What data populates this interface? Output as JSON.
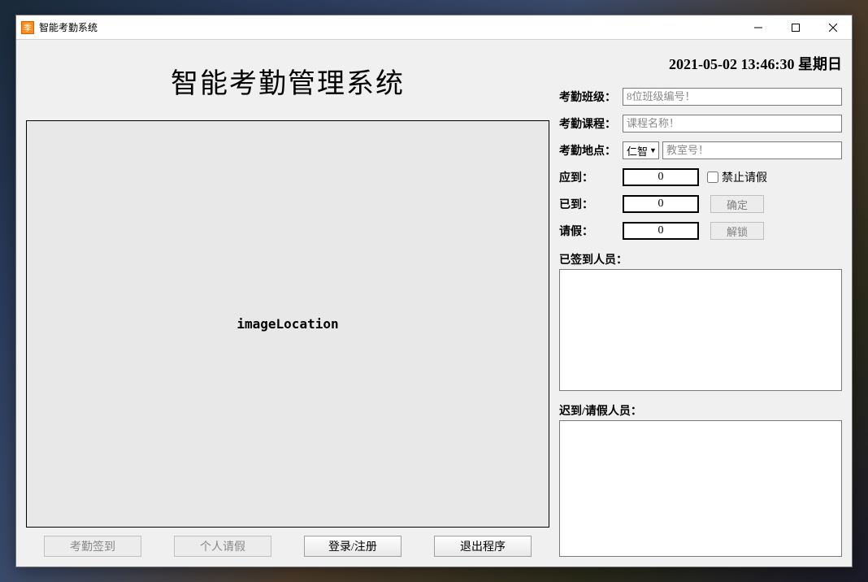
{
  "window": {
    "title": "智能考勤系统",
    "icon_glyph": "季"
  },
  "main_title": "智能考勤管理系统",
  "image_placeholder": "imageLocation",
  "datetime": "2021-05-02 13:46:30 星期日",
  "form": {
    "class_label": "考勤班级：",
    "class_placeholder": "8位班级编号！",
    "course_label": "考勤课程：",
    "course_placeholder": "课程名称！",
    "location_label": "考勤地点：",
    "building_selected": "仁智",
    "room_placeholder": "教室号！",
    "expected_label": "应到：",
    "expected_value": "0",
    "forbid_leave_label": "禁止请假",
    "arrived_label": "已到：",
    "arrived_value": "0",
    "confirm_label": "确定",
    "leave_label": "请假：",
    "leave_value": "0",
    "unlock_label": "解锁"
  },
  "sections": {
    "signed_label": "已签到人员：",
    "late_label": "迟到/请假人员："
  },
  "bottom_buttons": {
    "signin": "考勤签到",
    "personal_leave": "个人请假",
    "login": "登录/注册",
    "exit": "退出程序"
  }
}
